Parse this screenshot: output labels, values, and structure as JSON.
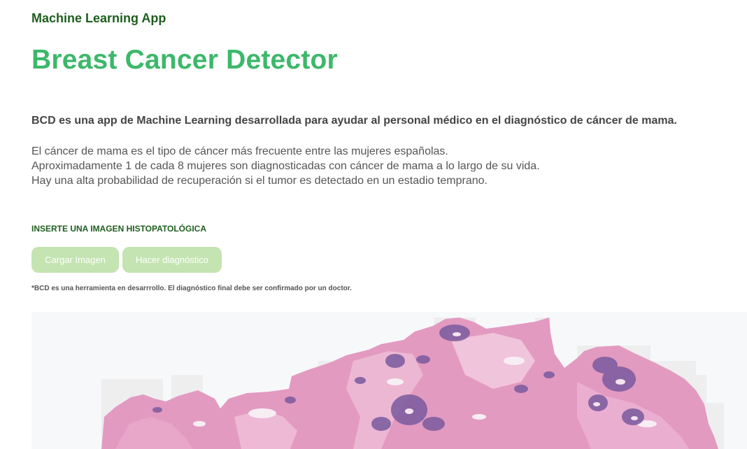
{
  "app": {
    "name": "Machine Learning App",
    "title": "Breast Cancer Detector"
  },
  "description": {
    "intro": "BCD es una app de Machine Learning desarrollada para ayudar al personal médico en el diagnóstico de cáncer de mama.",
    "facts": [
      "El cáncer de mama es el tipo de cáncer más frecuente entre las mujeres españolas.",
      "Aproximadamente 1 de cada 8 mujeres son diagnosticadas con cáncer de mama a lo largo de su vida.",
      "Hay una alta probabilidad de recuperación si el tumor es detectado en un estadio temprano."
    ]
  },
  "upload": {
    "section_label": "INSERTE UNA IMAGEN HISTOPATOLÓGICA",
    "upload_button": "Cargar Imagen",
    "diagnose_button": "Hacer diagnóstico",
    "disclaimer": "*BCD es una herramienta en desarrrollo. El diagnóstico final debe ser confirmado por un doctor."
  },
  "colors": {
    "app_name": "#1f5e1f",
    "title": "#3cb86a",
    "button_bg": "#c4e4b2",
    "tissue_pink": "#e39ac0",
    "tissue_purple": "#7a5a9e"
  }
}
